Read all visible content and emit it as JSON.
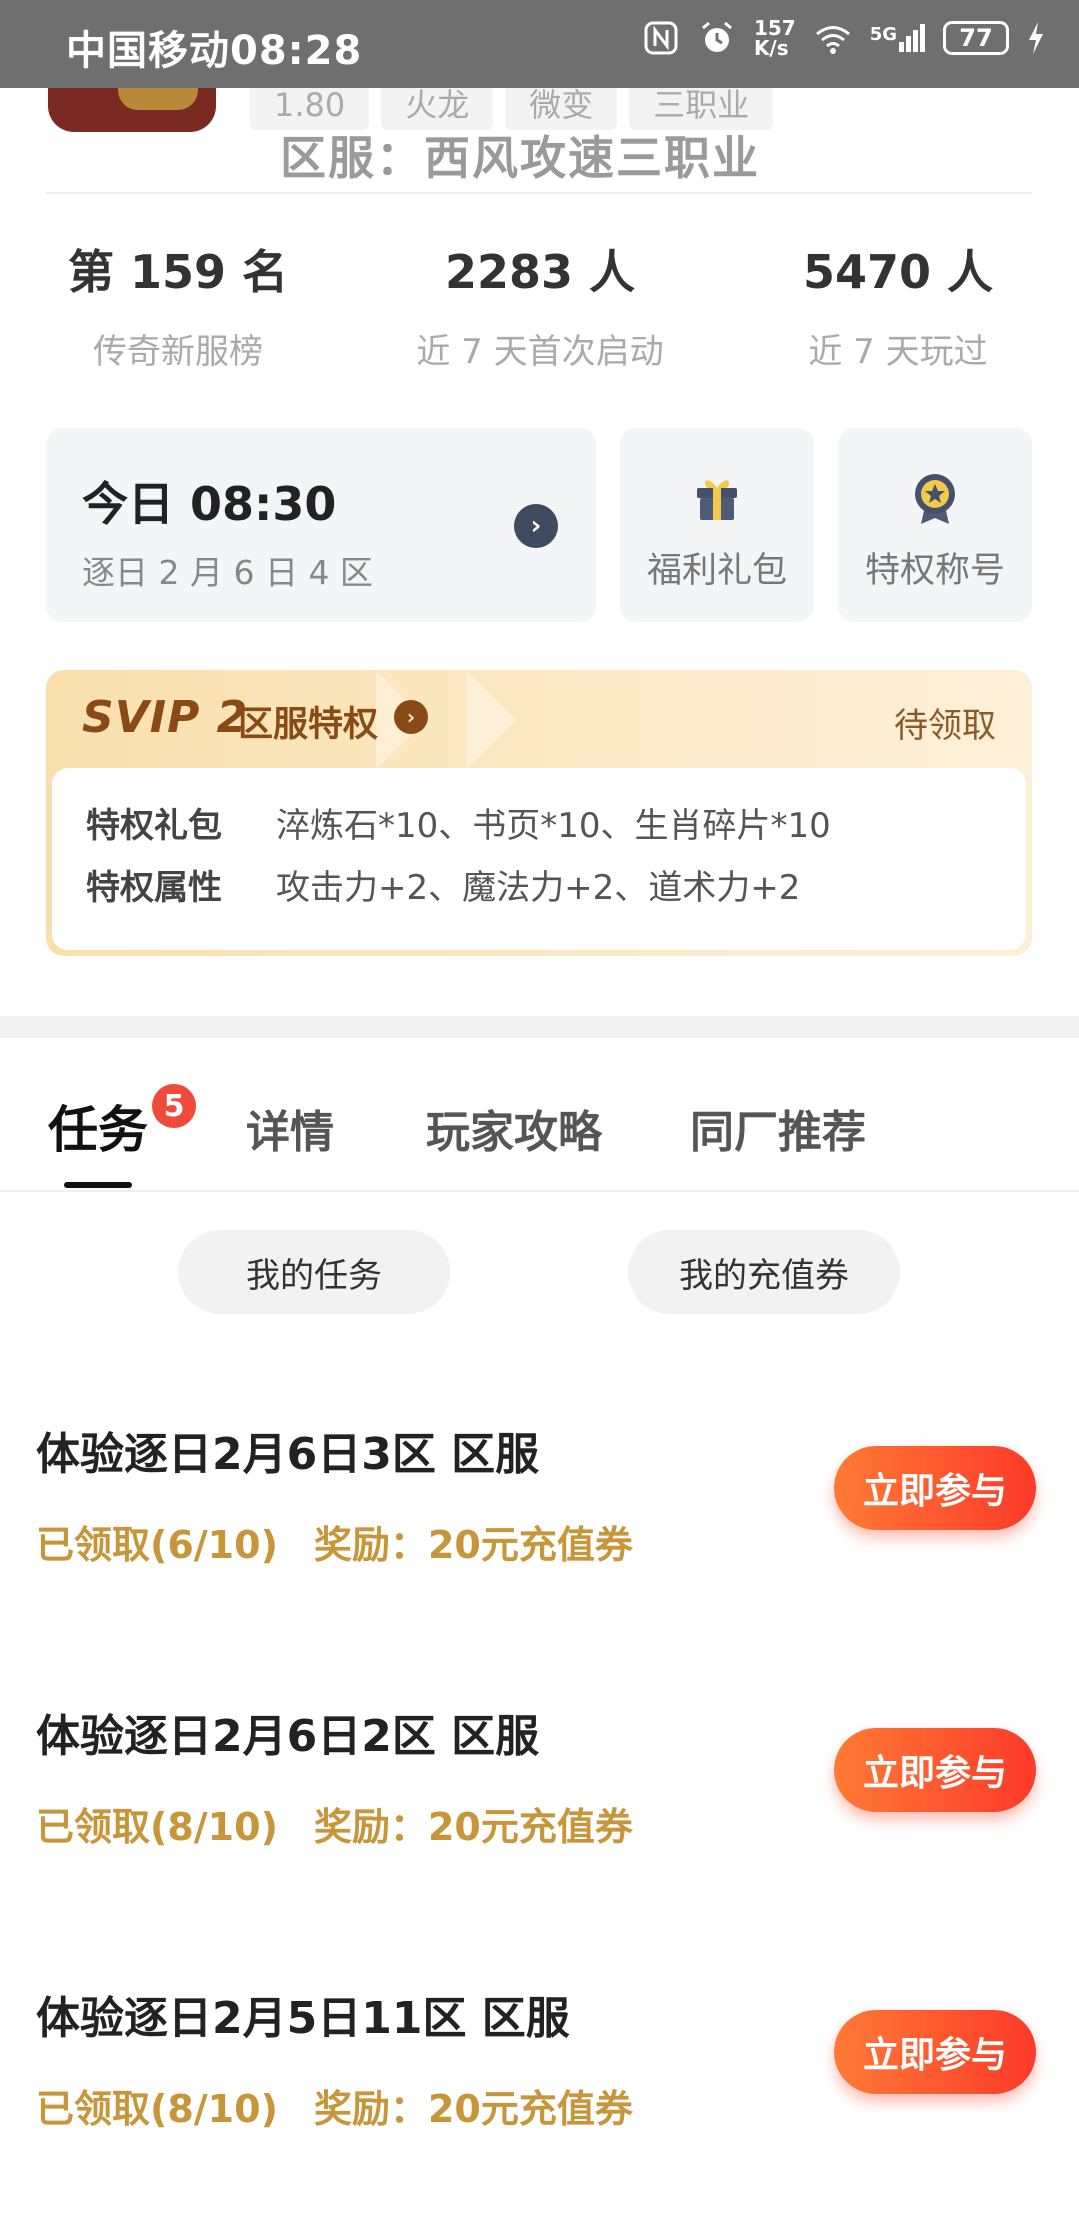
{
  "status_bar": {
    "carrier_time": "中国移动08:28",
    "net_speed_top": "157",
    "net_speed_bottom": "K/s",
    "network": "5G",
    "battery": "77"
  },
  "header": {
    "tags": [
      "1.80",
      "火龙",
      "微变",
      "三职业"
    ],
    "server_title": "区服：西风攻速三职业"
  },
  "stats": [
    {
      "value": "第 159 名",
      "label": "传奇新服榜"
    },
    {
      "value": "2283 人",
      "label": "近 7 天首次启动"
    },
    {
      "value": "5470 人",
      "label": "近 7 天玩过"
    }
  ],
  "open_card": {
    "time": "今日 08:30",
    "sub": "逐日 2 月 6 日 4 区"
  },
  "welfare_card": {
    "label": "福利礼包",
    "icon": "gift-icon"
  },
  "title_card": {
    "label": "特权称号",
    "icon": "medal-icon"
  },
  "svip": {
    "logo": "SVIP 2",
    "title": "区服特权",
    "status": "待领取",
    "rows": [
      {
        "key": "特权礼包",
        "value": "淬炼石*10、书页*10、生肖碎片*10"
      },
      {
        "key": "特权属性",
        "value": "攻击力+2、魔法力+2、道术力+2"
      }
    ]
  },
  "tabs": [
    {
      "label": "任务",
      "badge": "5",
      "active": true
    },
    {
      "label": "详情"
    },
    {
      "label": "玩家攻略"
    },
    {
      "label": "同厂推荐"
    }
  ],
  "segments": [
    "我的任务",
    "我的充值券"
  ],
  "tasks": [
    {
      "title": "体验逐日2月6日3区 区服",
      "claimed": "已领取(6/10)",
      "reward": "奖励：20元充值券",
      "button": "立即参与"
    },
    {
      "title": "体验逐日2月6日2区 区服",
      "claimed": "已领取(8/10)",
      "reward": "奖励：20元充值券",
      "button": "立即参与"
    },
    {
      "title": "体验逐日2月5日11区 区服",
      "claimed": "已领取(8/10)",
      "reward": "奖励：20元充值券",
      "button": "立即参与"
    }
  ],
  "colors": {
    "accent_orange": "#fc3a2a",
    "reward_gold": "#c8963a",
    "svip_brown": "#8a4a16",
    "badge_red": "#f04a3b"
  }
}
